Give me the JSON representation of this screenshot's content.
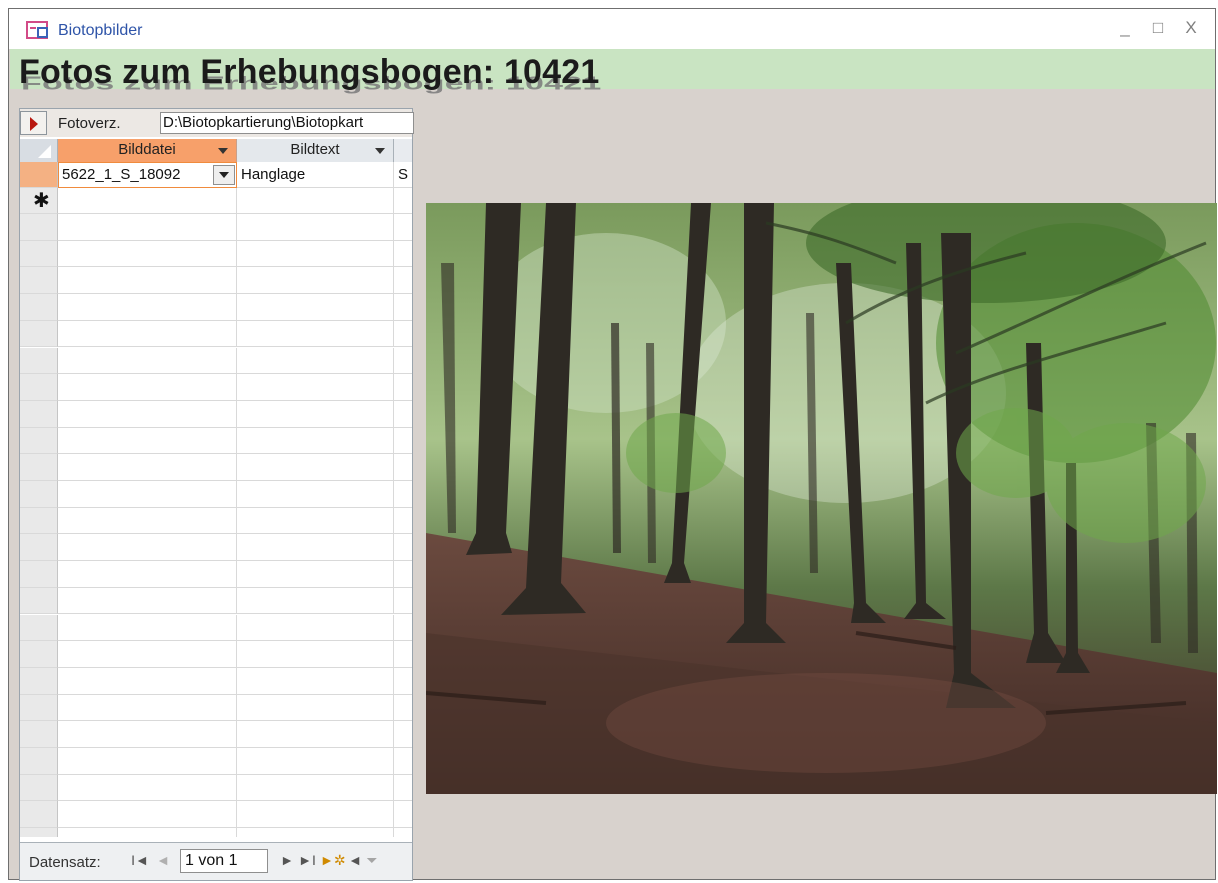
{
  "window": {
    "title": "Biotopbilder",
    "controls": {
      "minimize": "_",
      "maximize": "□",
      "close": "X"
    }
  },
  "form": {
    "heading": "Fotos zum Erhebungsbogen:  10421",
    "fotoverz_label": "Fotoverz.",
    "fotoverz_value": "D:\\Biotopkartierung\\Biotopkart"
  },
  "grid": {
    "columns": [
      "Bilddatei",
      "Bildtext",
      ""
    ],
    "rows": [
      {
        "bilddatei": "5622_1_S_18092",
        "bildtext": "Hanglage",
        "extra": "S"
      }
    ],
    "new_row_marker": "✱"
  },
  "navigation": {
    "label": "Datensatz:",
    "record": "1 von 1",
    "buttons": {
      "first": "I◄",
      "prev": "◄",
      "next": "►",
      "last": "►I",
      "new": "►✲",
      "filter": "Kein Filter"
    }
  },
  "photo": {
    "subject": "forest-hillside-photo"
  },
  "colors": {
    "header_band": "#c9e4c2",
    "active_column": "#f7a06a",
    "title_text": "#2e54a8",
    "record_selector": "#b81810"
  }
}
